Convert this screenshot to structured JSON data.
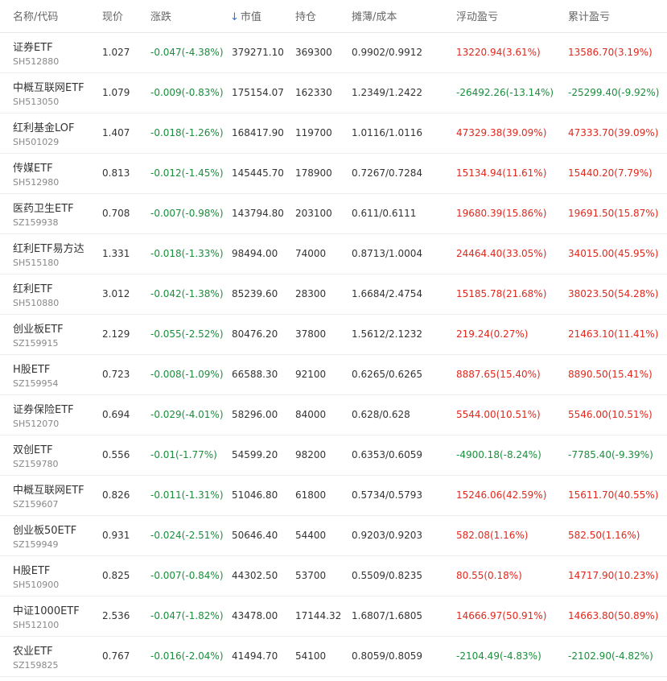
{
  "header": {
    "name": "名称/代码",
    "price": "现价",
    "change": "涨跌",
    "sort_arrow": "↓",
    "market_value": "市值",
    "position": "持仓",
    "cost": "摊薄/成本",
    "float_pnl": "浮动盈亏",
    "acc_pnl": "累计盈亏"
  },
  "colors": {
    "up": "#e0281d",
    "down": "#1a8f3c",
    "sort": "#2b73d6"
  },
  "rows": [
    {
      "name": "证券ETF",
      "code": "SH512880",
      "price": "1.027",
      "change": "-0.047(-4.38%)",
      "mv": "379271.10",
      "pos": "369300",
      "cost": "0.9902/0.9912",
      "float": "13220.94(3.61%)",
      "acc": "13586.70(3.19%)",
      "float_neg": false,
      "acc_neg": false
    },
    {
      "name": "中概互联网ETF",
      "code": "SH513050",
      "price": "1.079",
      "change": "-0.009(-0.83%)",
      "mv": "175154.07",
      "pos": "162330",
      "cost": "1.2349/1.2422",
      "float": "-26492.26(-13.14%)",
      "acc": "-25299.40(-9.92%)",
      "float_neg": true,
      "acc_neg": true
    },
    {
      "name": "红利基金LOF",
      "code": "SH501029",
      "price": "1.407",
      "change": "-0.018(-1.26%)",
      "mv": "168417.90",
      "pos": "119700",
      "cost": "1.0116/1.0116",
      "float": "47329.38(39.09%)",
      "acc": "47333.70(39.09%)",
      "float_neg": false,
      "acc_neg": false
    },
    {
      "name": "传媒ETF",
      "code": "SH512980",
      "price": "0.813",
      "change": "-0.012(-1.45%)",
      "mv": "145445.70",
      "pos": "178900",
      "cost": "0.7267/0.7284",
      "float": "15134.94(11.61%)",
      "acc": "15440.20(7.79%)",
      "float_neg": false,
      "acc_neg": false
    },
    {
      "name": "医药卫生ETF",
      "code": "SZ159938",
      "price": "0.708",
      "change": "-0.007(-0.98%)",
      "mv": "143794.80",
      "pos": "203100",
      "cost": "0.611/0.6111",
      "float": "19680.39(15.86%)",
      "acc": "19691.50(15.87%)",
      "float_neg": false,
      "acc_neg": false
    },
    {
      "name": "红利ETF易方达",
      "code": "SH515180",
      "price": "1.331",
      "change": "-0.018(-1.33%)",
      "mv": "98494.00",
      "pos": "74000",
      "cost": "0.8713/1.0004",
      "float": "24464.40(33.05%)",
      "acc": "34015.00(45.95%)",
      "float_neg": false,
      "acc_neg": false
    },
    {
      "name": "红利ETF",
      "code": "SH510880",
      "price": "3.012",
      "change": "-0.042(-1.38%)",
      "mv": "85239.60",
      "pos": "28300",
      "cost": "1.6684/2.4754",
      "float": "15185.78(21.68%)",
      "acc": "38023.50(54.28%)",
      "float_neg": false,
      "acc_neg": false
    },
    {
      "name": "创业板ETF",
      "code": "SZ159915",
      "price": "2.129",
      "change": "-0.055(-2.52%)",
      "mv": "80476.20",
      "pos": "37800",
      "cost": "1.5612/2.1232",
      "float": "219.24(0.27%)",
      "acc": "21463.10(11.41%)",
      "float_neg": false,
      "acc_neg": false
    },
    {
      "name": "H股ETF",
      "code": "SZ159954",
      "price": "0.723",
      "change": "-0.008(-1.09%)",
      "mv": "66588.30",
      "pos": "92100",
      "cost": "0.6265/0.6265",
      "float": "8887.65(15.40%)",
      "acc": "8890.50(15.41%)",
      "float_neg": false,
      "acc_neg": false
    },
    {
      "name": "证券保险ETF",
      "code": "SH512070",
      "price": "0.694",
      "change": "-0.029(-4.01%)",
      "mv": "58296.00",
      "pos": "84000",
      "cost": "0.628/0.628",
      "float": "5544.00(10.51%)",
      "acc": "5546.00(10.51%)",
      "float_neg": false,
      "acc_neg": false
    },
    {
      "name": "双创ETF",
      "code": "SZ159780",
      "price": "0.556",
      "change": "-0.01(-1.77%)",
      "mv": "54599.20",
      "pos": "98200",
      "cost": "0.6353/0.6059",
      "float": "-4900.18(-8.24%)",
      "acc": "-7785.40(-9.39%)",
      "float_neg": true,
      "acc_neg": true
    },
    {
      "name": "中概互联网ETF",
      "code": "SZ159607",
      "price": "0.826",
      "change": "-0.011(-1.31%)",
      "mv": "51046.80",
      "pos": "61800",
      "cost": "0.5734/0.5793",
      "float": "15246.06(42.59%)",
      "acc": "15611.70(40.55%)",
      "float_neg": false,
      "acc_neg": false
    },
    {
      "name": "创业板50ETF",
      "code": "SZ159949",
      "price": "0.931",
      "change": "-0.024(-2.51%)",
      "mv": "50646.40",
      "pos": "54400",
      "cost": "0.9203/0.9203",
      "float": "582.08(1.16%)",
      "acc": "582.50(1.16%)",
      "float_neg": false,
      "acc_neg": false
    },
    {
      "name": "H股ETF",
      "code": "SH510900",
      "price": "0.825",
      "change": "-0.007(-0.84%)",
      "mv": "44302.50",
      "pos": "53700",
      "cost": "0.5509/0.8235",
      "float": "80.55(0.18%)",
      "acc": "14717.90(10.23%)",
      "float_neg": false,
      "acc_neg": false
    },
    {
      "name": "中证1000ETF",
      "code": "SH512100",
      "price": "2.536",
      "change": "-0.047(-1.82%)",
      "mv": "43478.00",
      "pos": "17144.32",
      "cost": "1.6807/1.6805",
      "float": "14666.97(50.91%)",
      "acc": "14663.80(50.89%)",
      "float_neg": false,
      "acc_neg": false
    },
    {
      "name": "农业ETF",
      "code": "SZ159825",
      "price": "0.767",
      "change": "-0.016(-2.04%)",
      "mv": "41494.70",
      "pos": "54100",
      "cost": "0.8059/0.8059",
      "float": "-2104.49(-4.83%)",
      "acc": "-2102.90(-4.82%)",
      "float_neg": true,
      "acc_neg": true
    }
  ]
}
